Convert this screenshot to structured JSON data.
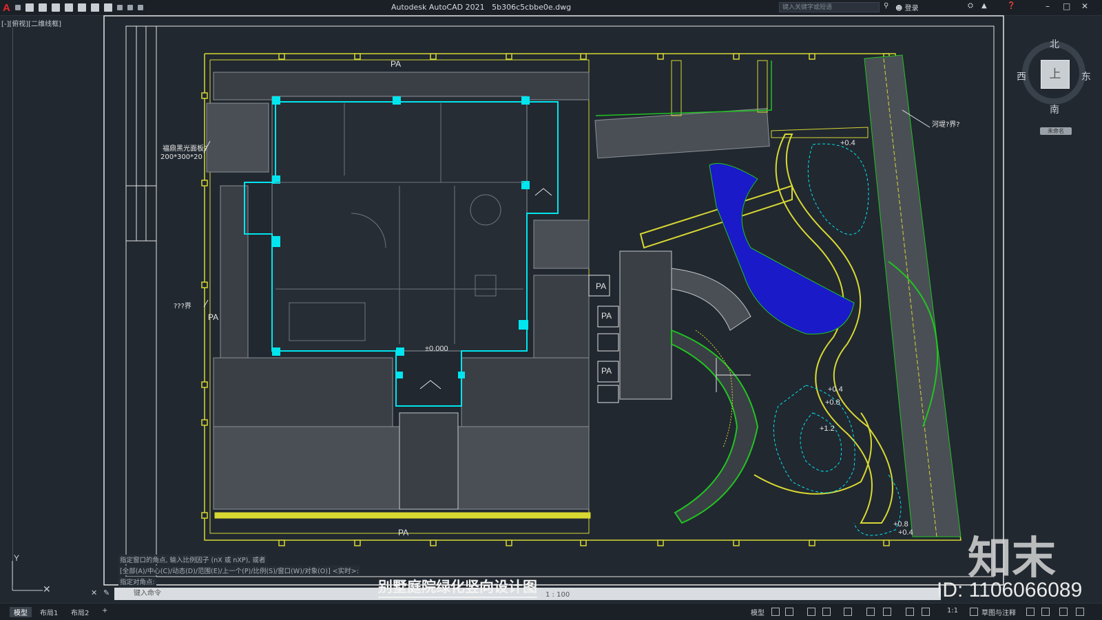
{
  "app": {
    "title": "Autodesk AutoCAD 2021",
    "filename": "5b306c5cbbe0e.dwg",
    "search_placeholder": "键入关键字或短语",
    "login": "登录",
    "help_icon": "help-icon"
  },
  "viewport": {
    "label": "[-][俯视][二维线框]",
    "viewcube": {
      "north": "北",
      "south": "南",
      "east": "东",
      "west": "西",
      "top": "上",
      "ucs": "未命名"
    },
    "ucs_axis_y": "Y"
  },
  "drawing": {
    "pa_labels": [
      "PA",
      "PA",
      "PA",
      "PA",
      "PA",
      "PA"
    ],
    "elevation_center": "±0.000",
    "elevations": [
      "+0.4",
      "+0.4",
      "+0.8",
      "+1.2",
      "+0.8",
      "+0.4"
    ],
    "annotations": [
      "福鼎黑光面板?",
      "200*300*20",
      "???界",
      "河堤?界?"
    ],
    "title_block_items": [
      "?",
      "?",
      "?",
      "?",
      "?",
      "?"
    ]
  },
  "command": {
    "history": [
      "指定窗口的角点, 输入比例因子 (nX 或 nXP), 或者",
      "[全部(A)/中心(C)/动态(D)/范围(E)/上一个(P)/比例(S)/窗口(W)/对象(O)] <实时>:",
      "指定对角点:"
    ],
    "input_placeholder": "键入命令",
    "scale_text": "1 : 100"
  },
  "caption": "别墅庭院绿化竖向设计图",
  "status": {
    "tabs": [
      "模型",
      "布局1",
      "布局2"
    ],
    "add_tab": "+",
    "model_button": "模型",
    "scale": "1:1",
    "workspace": "草图与注释"
  },
  "watermark": {
    "brand": "知末",
    "id": "ID: 1106066089"
  },
  "colors": {
    "yellow": "#d8d832",
    "cyan": "#00e5ee",
    "green": "#21c421",
    "blue": "#1a1ac8",
    "gray": "#8c9196",
    "bg": "#212830"
  }
}
